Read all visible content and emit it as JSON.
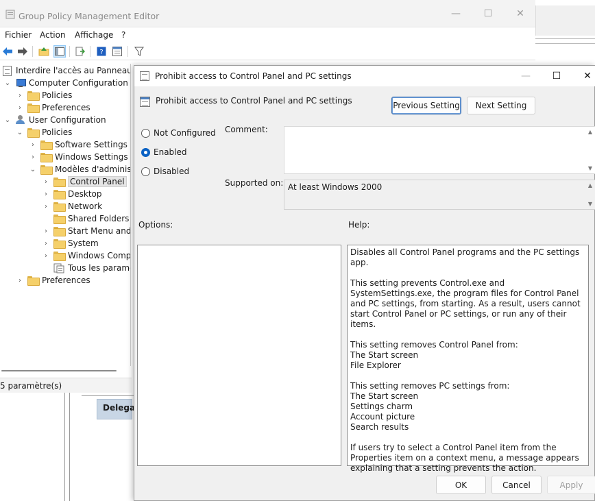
{
  "parent_window": {
    "title": "Group Policy Management Editor",
    "controls": {
      "minimize": "—",
      "maximize": "☐",
      "close": "✕"
    },
    "menu": [
      "Fichier",
      "Action",
      "Affichage",
      "?"
    ],
    "status_text": "5 paramètre(s)",
    "behind_item": "Delegati"
  },
  "tree": {
    "items": [
      {
        "label": "Interdire l'accès au Panneau de",
        "icon": "policy-doc-icon"
      },
      {
        "label": "Computer Configuration",
        "icon": "computer-icon",
        "chevron": "v"
      },
      {
        "label": "Policies",
        "icon": "folder-icon",
        "chevron": ">"
      },
      {
        "label": "Preferences",
        "icon": "folder-icon",
        "chevron": ">"
      },
      {
        "label": "User Configuration",
        "icon": "user-icon",
        "chevron": "v"
      },
      {
        "label": "Policies",
        "icon": "folder-icon",
        "chevron": "v"
      },
      {
        "label": "Software Settings",
        "icon": "folder-icon",
        "chevron": ">"
      },
      {
        "label": "Windows Settings",
        "icon": "folder-icon",
        "chevron": ">"
      },
      {
        "label": "Modèles d'administr",
        "icon": "folder-icon",
        "chevron": "v"
      },
      {
        "label": "Control Panel",
        "icon": "folder-icon",
        "chevron": ">",
        "selected": true
      },
      {
        "label": "Desktop",
        "icon": "folder-icon",
        "chevron": ">"
      },
      {
        "label": "Network",
        "icon": "folder-icon",
        "chevron": ">"
      },
      {
        "label": "Shared Folders",
        "icon": "folder-icon"
      },
      {
        "label": "Start Menu and T",
        "icon": "folder-icon",
        "chevron": ">"
      },
      {
        "label": "System",
        "icon": "folder-icon",
        "chevron": ">"
      },
      {
        "label": "Windows Compo",
        "icon": "folder-icon",
        "chevron": ">"
      },
      {
        "label": "Tous les paramèt",
        "icon": "all-settings-icon"
      },
      {
        "label": "Preferences",
        "icon": "folder-icon",
        "chevron": ">"
      }
    ]
  },
  "dialog": {
    "title": "Prohibit access to Control Panel and PC settings",
    "controls": {
      "minimize": "—",
      "maximize": "☐",
      "close": "✕"
    },
    "setting_name": "Prohibit access to Control Panel and PC settings",
    "previous_label": "Previous Setting",
    "next_label": "Next Setting",
    "options": {
      "not_configured": "Not Configured",
      "enabled": "Enabled",
      "disabled": "Disabled",
      "selected": "enabled"
    },
    "comment_label": "Comment:",
    "comment_value": "",
    "supported_label": "Supported on:",
    "supported_value": "At least Windows 2000",
    "options_label": "Options:",
    "help_label": "Help:",
    "help_text": "Disables all Control Panel programs and the PC settings app.\n\nThis setting prevents Control.exe and SystemSettings.exe, the program files for Control Panel and PC settings, from starting. As a result, users cannot start Control Panel or PC settings, or run any of their items.\n\nThis setting removes Control Panel from:\nThe Start screen\nFile Explorer\n\nThis setting removes PC settings from:\nThe Start screen\nSettings charm\nAccount picture\nSearch results\n\nIf users try to select a Control Panel item from the Properties item on a context menu, a message appears explaining that a setting prevents the action.",
    "ok_label": "OK",
    "cancel_label": "Cancel",
    "apply_label": "Apply"
  }
}
